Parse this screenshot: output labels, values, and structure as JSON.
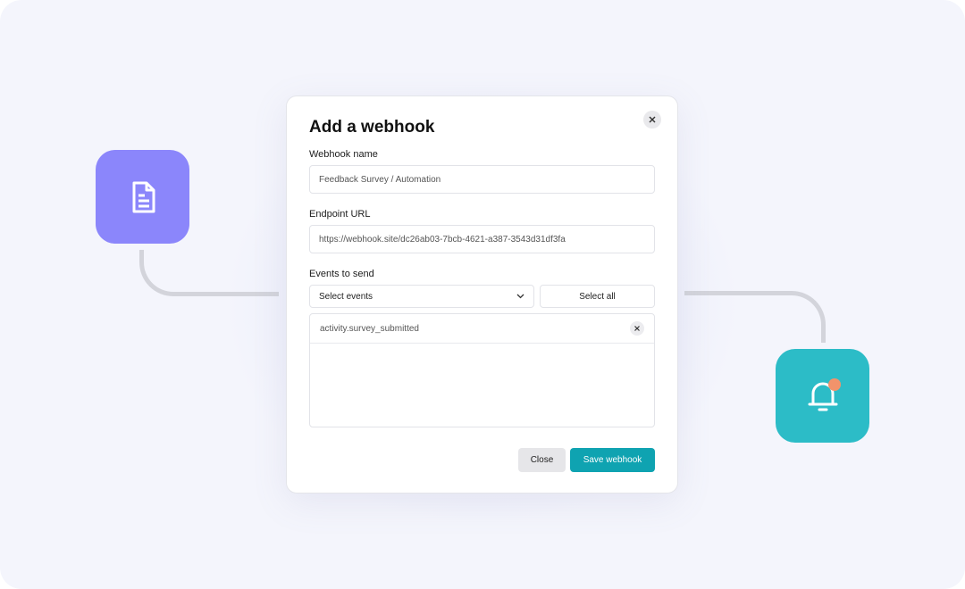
{
  "modal": {
    "title": "Add a webhook",
    "webhook_name_label": "Webhook name",
    "webhook_name_value": "Feedback Survey / Automation",
    "endpoint_label": "Endpoint URL",
    "endpoint_value": "https://webhook.site/dc26ab03-7bcb-4621-a387-3543d31df3fa",
    "events_label": "Events to send",
    "select_placeholder": "Select events",
    "select_all_label": "Select all",
    "events": [
      {
        "name": "activity.survey_submitted"
      }
    ],
    "close_label": "Close",
    "save_label": "Save webhook"
  },
  "icons": {
    "left_tile": "document-icon",
    "right_tile": "bell-icon",
    "close": "close-icon",
    "dropdown": "chevron-down-icon"
  },
  "colors": {
    "doc_tile": "#8b86fb",
    "bell_tile": "#2cbcc7",
    "notification_dot": "#f2936b",
    "primary_button": "#0fa3b1",
    "background": "#f4f5fc"
  }
}
